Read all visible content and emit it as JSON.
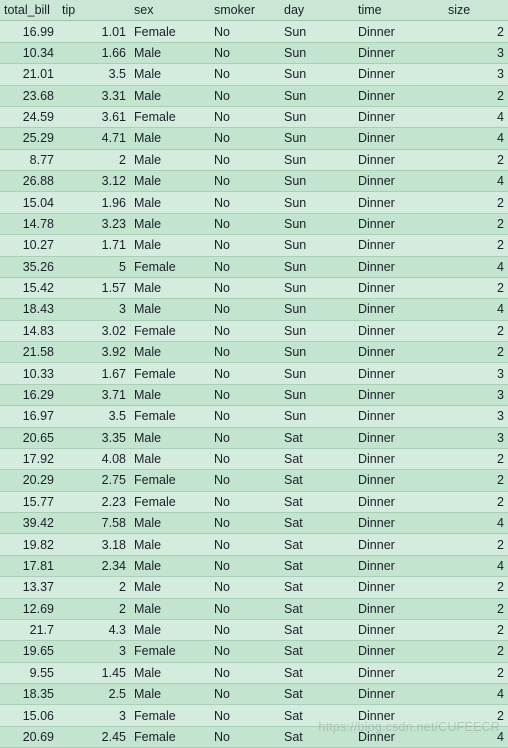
{
  "columns": {
    "total_bill": "total_bill",
    "tip": "tip",
    "sex": "sex",
    "smoker": "smoker",
    "day": "day",
    "time": "time",
    "size": "size"
  },
  "rows": [
    {
      "total_bill": "16.99",
      "tip": "1.01",
      "sex": "Female",
      "smoker": "No",
      "day": "Sun",
      "time": "Dinner",
      "size": "2"
    },
    {
      "total_bill": "10.34",
      "tip": "1.66",
      "sex": "Male",
      "smoker": "No",
      "day": "Sun",
      "time": "Dinner",
      "size": "3"
    },
    {
      "total_bill": "21.01",
      "tip": "3.5",
      "sex": "Male",
      "smoker": "No",
      "day": "Sun",
      "time": "Dinner",
      "size": "3"
    },
    {
      "total_bill": "23.68",
      "tip": "3.31",
      "sex": "Male",
      "smoker": "No",
      "day": "Sun",
      "time": "Dinner",
      "size": "2"
    },
    {
      "total_bill": "24.59",
      "tip": "3.61",
      "sex": "Female",
      "smoker": "No",
      "day": "Sun",
      "time": "Dinner",
      "size": "4"
    },
    {
      "total_bill": "25.29",
      "tip": "4.71",
      "sex": "Male",
      "smoker": "No",
      "day": "Sun",
      "time": "Dinner",
      "size": "4"
    },
    {
      "total_bill": "8.77",
      "tip": "2",
      "sex": "Male",
      "smoker": "No",
      "day": "Sun",
      "time": "Dinner",
      "size": "2"
    },
    {
      "total_bill": "26.88",
      "tip": "3.12",
      "sex": "Male",
      "smoker": "No",
      "day": "Sun",
      "time": "Dinner",
      "size": "4"
    },
    {
      "total_bill": "15.04",
      "tip": "1.96",
      "sex": "Male",
      "smoker": "No",
      "day": "Sun",
      "time": "Dinner",
      "size": "2"
    },
    {
      "total_bill": "14.78",
      "tip": "3.23",
      "sex": "Male",
      "smoker": "No",
      "day": "Sun",
      "time": "Dinner",
      "size": "2"
    },
    {
      "total_bill": "10.27",
      "tip": "1.71",
      "sex": "Male",
      "smoker": "No",
      "day": "Sun",
      "time": "Dinner",
      "size": "2"
    },
    {
      "total_bill": "35.26",
      "tip": "5",
      "sex": "Female",
      "smoker": "No",
      "day": "Sun",
      "time": "Dinner",
      "size": "4"
    },
    {
      "total_bill": "15.42",
      "tip": "1.57",
      "sex": "Male",
      "smoker": "No",
      "day": "Sun",
      "time": "Dinner",
      "size": "2"
    },
    {
      "total_bill": "18.43",
      "tip": "3",
      "sex": "Male",
      "smoker": "No",
      "day": "Sun",
      "time": "Dinner",
      "size": "4"
    },
    {
      "total_bill": "14.83",
      "tip": "3.02",
      "sex": "Female",
      "smoker": "No",
      "day": "Sun",
      "time": "Dinner",
      "size": "2"
    },
    {
      "total_bill": "21.58",
      "tip": "3.92",
      "sex": "Male",
      "smoker": "No",
      "day": "Sun",
      "time": "Dinner",
      "size": "2"
    },
    {
      "total_bill": "10.33",
      "tip": "1.67",
      "sex": "Female",
      "smoker": "No",
      "day": "Sun",
      "time": "Dinner",
      "size": "3"
    },
    {
      "total_bill": "16.29",
      "tip": "3.71",
      "sex": "Male",
      "smoker": "No",
      "day": "Sun",
      "time": "Dinner",
      "size": "3"
    },
    {
      "total_bill": "16.97",
      "tip": "3.5",
      "sex": "Female",
      "smoker": "No",
      "day": "Sun",
      "time": "Dinner",
      "size": "3"
    },
    {
      "total_bill": "20.65",
      "tip": "3.35",
      "sex": "Male",
      "smoker": "No",
      "day": "Sat",
      "time": "Dinner",
      "size": "3"
    },
    {
      "total_bill": "17.92",
      "tip": "4.08",
      "sex": "Male",
      "smoker": "No",
      "day": "Sat",
      "time": "Dinner",
      "size": "2"
    },
    {
      "total_bill": "20.29",
      "tip": "2.75",
      "sex": "Female",
      "smoker": "No",
      "day": "Sat",
      "time": "Dinner",
      "size": "2"
    },
    {
      "total_bill": "15.77",
      "tip": "2.23",
      "sex": "Female",
      "smoker": "No",
      "day": "Sat",
      "time": "Dinner",
      "size": "2"
    },
    {
      "total_bill": "39.42",
      "tip": "7.58",
      "sex": "Male",
      "smoker": "No",
      "day": "Sat",
      "time": "Dinner",
      "size": "4"
    },
    {
      "total_bill": "19.82",
      "tip": "3.18",
      "sex": "Male",
      "smoker": "No",
      "day": "Sat",
      "time": "Dinner",
      "size": "2"
    },
    {
      "total_bill": "17.81",
      "tip": "2.34",
      "sex": "Male",
      "smoker": "No",
      "day": "Sat",
      "time": "Dinner",
      "size": "4"
    },
    {
      "total_bill": "13.37",
      "tip": "2",
      "sex": "Male",
      "smoker": "No",
      "day": "Sat",
      "time": "Dinner",
      "size": "2"
    },
    {
      "total_bill": "12.69",
      "tip": "2",
      "sex": "Male",
      "smoker": "No",
      "day": "Sat",
      "time": "Dinner",
      "size": "2"
    },
    {
      "total_bill": "21.7",
      "tip": "4.3",
      "sex": "Male",
      "smoker": "No",
      "day": "Sat",
      "time": "Dinner",
      "size": "2"
    },
    {
      "total_bill": "19.65",
      "tip": "3",
      "sex": "Female",
      "smoker": "No",
      "day": "Sat",
      "time": "Dinner",
      "size": "2"
    },
    {
      "total_bill": "9.55",
      "tip": "1.45",
      "sex": "Male",
      "smoker": "No",
      "day": "Sat",
      "time": "Dinner",
      "size": "2"
    },
    {
      "total_bill": "18.35",
      "tip": "2.5",
      "sex": "Male",
      "smoker": "No",
      "day": "Sat",
      "time": "Dinner",
      "size": "4"
    },
    {
      "total_bill": "15.06",
      "tip": "3",
      "sex": "Female",
      "smoker": "No",
      "day": "Sat",
      "time": "Dinner",
      "size": "2"
    },
    {
      "total_bill": "20.69",
      "tip": "2.45",
      "sex": "Female",
      "smoker": "No",
      "day": "Sat",
      "time": "Dinner",
      "size": "4"
    }
  ],
  "watermark": "https://blog.csdn.net/CUFEECR"
}
